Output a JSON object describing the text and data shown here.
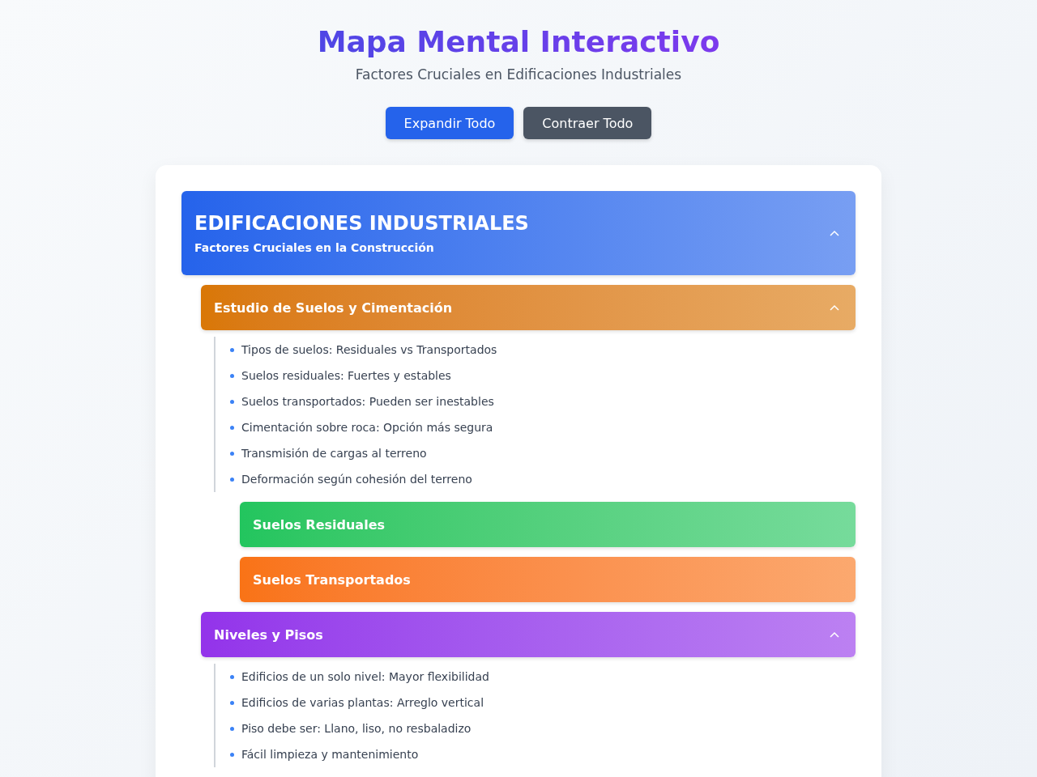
{
  "header": {
    "title": "Mapa Mental Interactivo",
    "subtitle": "Factores Cruciales en Edificaciones Industriales"
  },
  "buttons": [
    {
      "label": "Expandir Todo",
      "kind": "primary"
    },
    {
      "label": "Contraer Todo",
      "kind": "secondary"
    }
  ],
  "root": {
    "title": "EDIFICACIONES INDUSTRIALES",
    "subtitle": "Factores Cruciales en la Construcción",
    "color": "#2563eb",
    "expanded": true,
    "children": [
      {
        "title": "Estudio de Suelos y Cimentación",
        "color": "#d97706",
        "expanded": true,
        "items": [
          "Tipos de suelos: Residuales vs Transportados",
          "Suelos residuales: Fuertes y estables",
          "Suelos transportados: Pueden ser inestables",
          "Cimentación sobre roca: Opción más segura",
          "Transmisión de cargas al terreno",
          "Deformación según cohesión del terreno"
        ],
        "children": [
          {
            "title": "Suelos Residuales",
            "color": "#22c55e",
            "expanded": false
          },
          {
            "title": "Suelos Transportados",
            "color": "#f97316",
            "expanded": false
          }
        ]
      },
      {
        "title": "Niveles y Pisos",
        "color": "#9333ea",
        "expanded": true,
        "items": [
          "Edificios de un solo nivel: Mayor flexibilidad",
          "Edificios de varias plantas: Arreglo vertical",
          "Piso debe ser: Llano, liso, no resbaladizo",
          "Fácil limpieza y mantenimiento"
        ]
      }
    ]
  }
}
